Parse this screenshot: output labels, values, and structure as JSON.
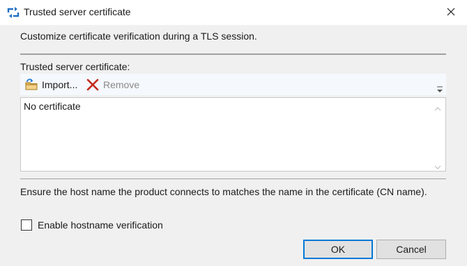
{
  "window": {
    "title": "Trusted server certificate",
    "app_icon": "refresh-arrows-icon",
    "close_icon": "close-icon"
  },
  "description": "Customize certificate verification during a TLS session.",
  "certificate_section": {
    "label": "Trusted server certificate:",
    "toolbar": {
      "import_label": "Import...",
      "import_icon": "import-folder-icon",
      "remove_label": "Remove",
      "remove_icon": "red-x-icon",
      "remove_enabled": false,
      "overflow_icon": "chevron-down-icon"
    },
    "list": {
      "items": [
        "No certificate"
      ]
    }
  },
  "hostname": {
    "description": "Ensure the host name the product connects to matches the name in the certificate (CN name).",
    "checkbox_label": "Enable hostname verification",
    "checked": false
  },
  "buttons": {
    "ok_label": "OK",
    "cancel_label": "Cancel"
  },
  "colors": {
    "accent": "#0078d7",
    "remove_icon": "#c42b1c",
    "disabled_text": "#8a8a8a"
  }
}
